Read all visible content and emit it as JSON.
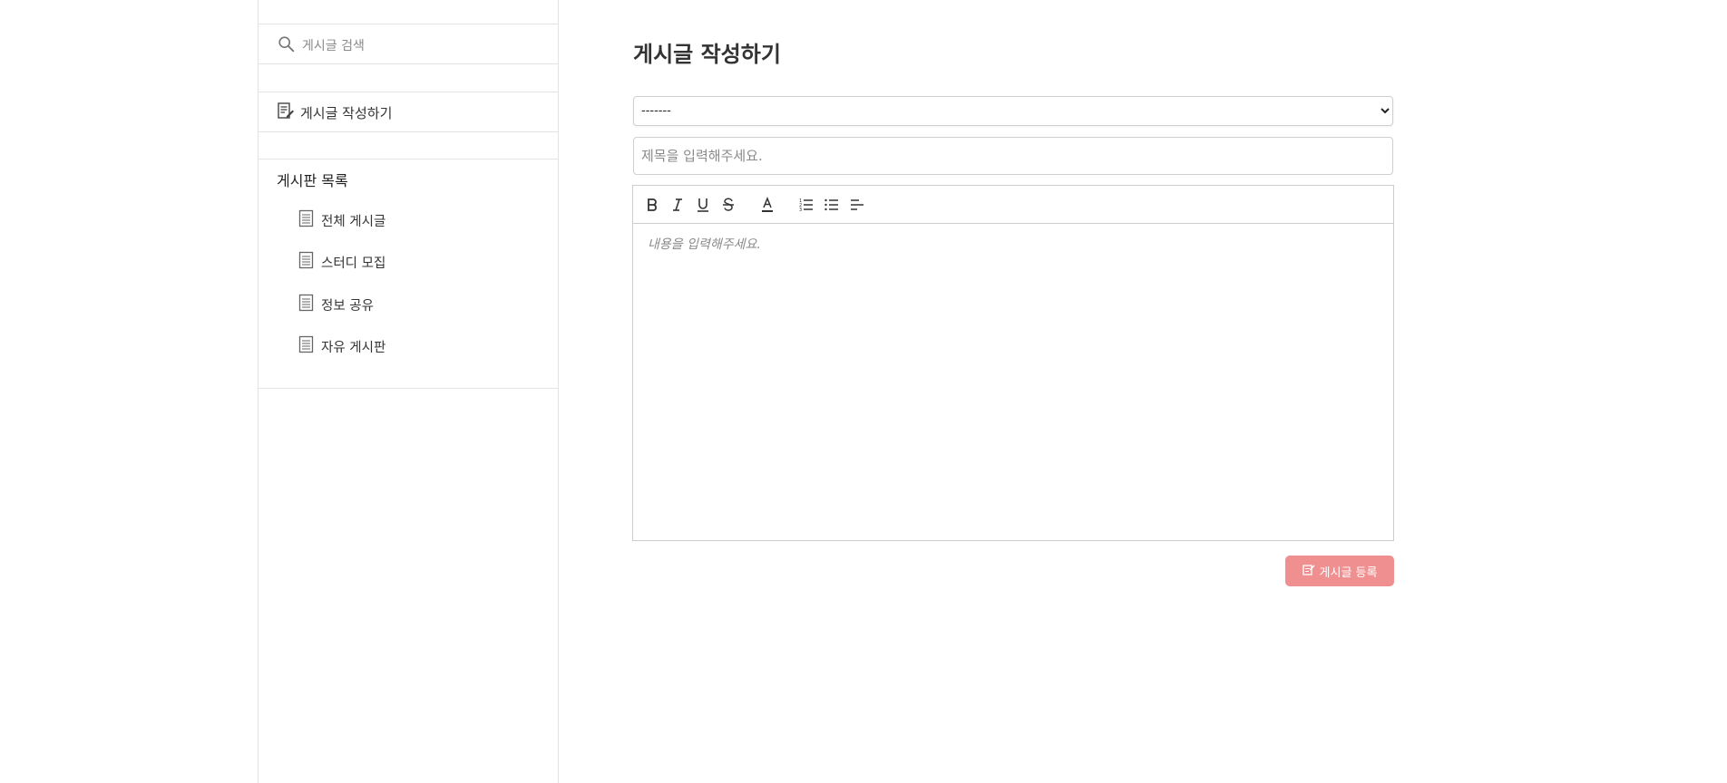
{
  "sidebar": {
    "search": {
      "placeholder": "게시글 검색",
      "icon": "search-icon"
    },
    "write_link": {
      "label": "게시글 작성하기",
      "icon": "edit-document-icon"
    },
    "board_list": {
      "title": "게시판 목록",
      "items": [
        {
          "label": "전체 게시글",
          "icon": "document-icon"
        },
        {
          "label": "스터디 모집",
          "icon": "document-icon"
        },
        {
          "label": "정보 공유",
          "icon": "document-icon"
        },
        {
          "label": "자유 게시판",
          "icon": "document-icon"
        }
      ]
    }
  },
  "main": {
    "page_title": "게시글 작성하기",
    "category_select": {
      "selected": "-------"
    },
    "title_input": {
      "placeholder": "제목을 입력해주세요."
    },
    "editor": {
      "placeholder": "내용을 입력해주세요.",
      "toolbar": [
        "bold-icon",
        "italic-icon",
        "underline-icon",
        "strikethrough-icon",
        "font-color-icon",
        "ordered-list-icon",
        "bullet-list-icon",
        "align-left-icon"
      ]
    },
    "submit_button": {
      "label": "게시글 등록",
      "icon": "edit-icon",
      "background": "#ef8f8f"
    }
  }
}
